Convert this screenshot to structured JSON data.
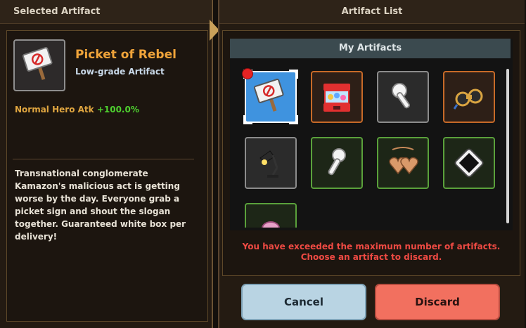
{
  "selected_panel": {
    "title": "Selected Artifact",
    "artifact": {
      "name": "Picket of Rebel",
      "grade": "Low-grade Artifact",
      "icon": "picket-sign-icon",
      "stat_label": "Normal Hero Atk",
      "stat_value": "+100.0%",
      "description": "Transnational conglomerate Kamazon's malicious act is getting worse by the day. Everyone grab a picket sign and shout the slogan together. Guaranteed white box per delivery!"
    }
  },
  "list_panel": {
    "title": "Artifact List",
    "section_title": "My Artifacts",
    "items": [
      {
        "icon": "picket-sign-icon",
        "rarity": "selected"
      },
      {
        "icon": "gacha-machine-icon",
        "rarity": "rare"
      },
      {
        "icon": "earbud-icon",
        "rarity": "common"
      },
      {
        "icon": "binoculars-icon",
        "rarity": "rare"
      },
      {
        "icon": "desk-lamp-icon",
        "rarity": "common"
      },
      {
        "icon": "earbud-icon",
        "rarity": "uncommon"
      },
      {
        "icon": "heart-locket-icon",
        "rarity": "uncommon"
      },
      {
        "icon": "tablet-icon",
        "rarity": "uncommon"
      },
      {
        "icon": "pink-item-icon",
        "rarity": "uncommon"
      }
    ],
    "warning_line1": "You have exceeded the maximum number of artifacts.",
    "warning_line2": "Choose an artifact to discard."
  },
  "buttons": {
    "cancel": "Cancel",
    "discard": "Discard"
  },
  "colors": {
    "accent_gold": "#f0a43a",
    "stat_green": "#4ed12f",
    "warning_red": "#ee4a43",
    "cancel_bg": "#b9d4e3",
    "discard_bg": "#f2705f"
  }
}
